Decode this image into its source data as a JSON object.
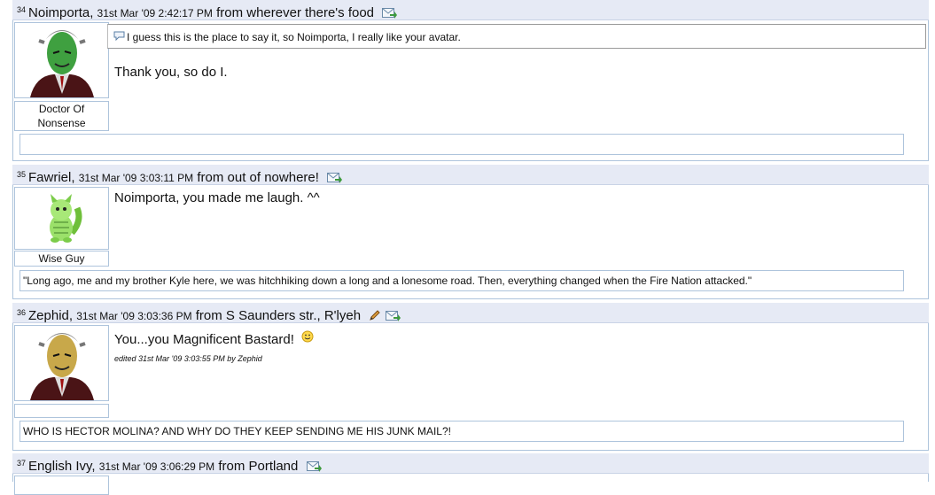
{
  "posts": [
    {
      "number": "34",
      "author": "Noimporta,",
      "date": "31st Mar '09 2:42:17 PM",
      "location": "from wherever there's food",
      "user_title": "Doctor Of Nonsense",
      "quote": "I guess this is the place to say it, so Noimporta, I really like your avatar.",
      "body": "Thank you, so do I.",
      "signature": ""
    },
    {
      "number": "35",
      "author": "Fawriel,",
      "date": "31st Mar '09 3:03:11 PM",
      "location": "from out of nowhere!",
      "user_title": "Wise Guy",
      "body": "Noimporta, you made me laugh. ^^",
      "signature": "\"Long ago, me and my brother Kyle here, we was hitchhiking down a long and a lonesome road. Then, everything changed when the Fire Nation attacked.\""
    },
    {
      "number": "36",
      "author": "Zephid,",
      "date": "31st Mar '09 3:03:36 PM",
      "location": "from S Saunders str., R'lyeh",
      "user_title": "",
      "body": "You...you Magnificent Bastard!",
      "edited": "edited 31st Mar '09 3:03:55 PM by Zephid",
      "signature": "WHO IS HECTOR MOLINA? AND WHY DO THEY KEEP SENDING ME HIS JUNK MAIL?!"
    },
    {
      "number": "37",
      "author": "English Ivy,",
      "date": "31st Mar '09 3:06:29 PM",
      "location": "from Portland"
    }
  ]
}
